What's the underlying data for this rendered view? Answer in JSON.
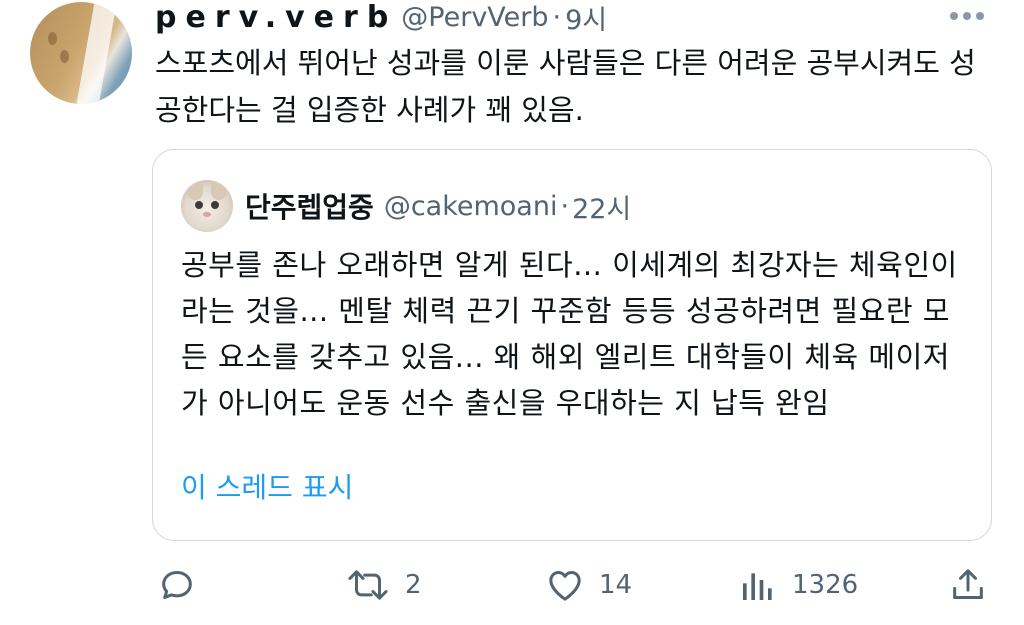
{
  "tweet": {
    "display_name": "perv.verb",
    "handle": "@PervVerb",
    "separator": "·",
    "time": "9시",
    "text": "스포츠에서 뛰어난 성과를 이룬 사람들은 다른 어려운 공부시켜도 성공한다는 걸 입증한 사례가 꽤 있음."
  },
  "quote": {
    "display_name": "단주렙업중",
    "handle": "@cakemoani",
    "separator": "·",
    "time": "22시",
    "text": "공부를 존나 오래하면 알게 된다... 이세계의 최강자는 체육인이라는 것을... 멘탈 체력 끈기 꾸준함 등등 성공하려면 필요란 모든 요소를 갖추고 있음... 왜 해외 엘리트 대학들이 체육 메이저가 아니어도 운동 선수 출신을 우대하는 지 납득 완임",
    "show_thread_label": "이 스레드 표시"
  },
  "actions": {
    "reply_icon": "reply-icon",
    "retweet_icon": "retweet-icon",
    "retweet_count": "2",
    "like_icon": "heart-icon",
    "like_count": "14",
    "views_icon": "views-icon",
    "views_count": "1326",
    "share_icon": "share-icon"
  },
  "colors": {
    "text_primary": "#0f1419",
    "text_secondary": "#536471",
    "link_blue": "#1d9bf0",
    "border": "#cfd9de"
  }
}
